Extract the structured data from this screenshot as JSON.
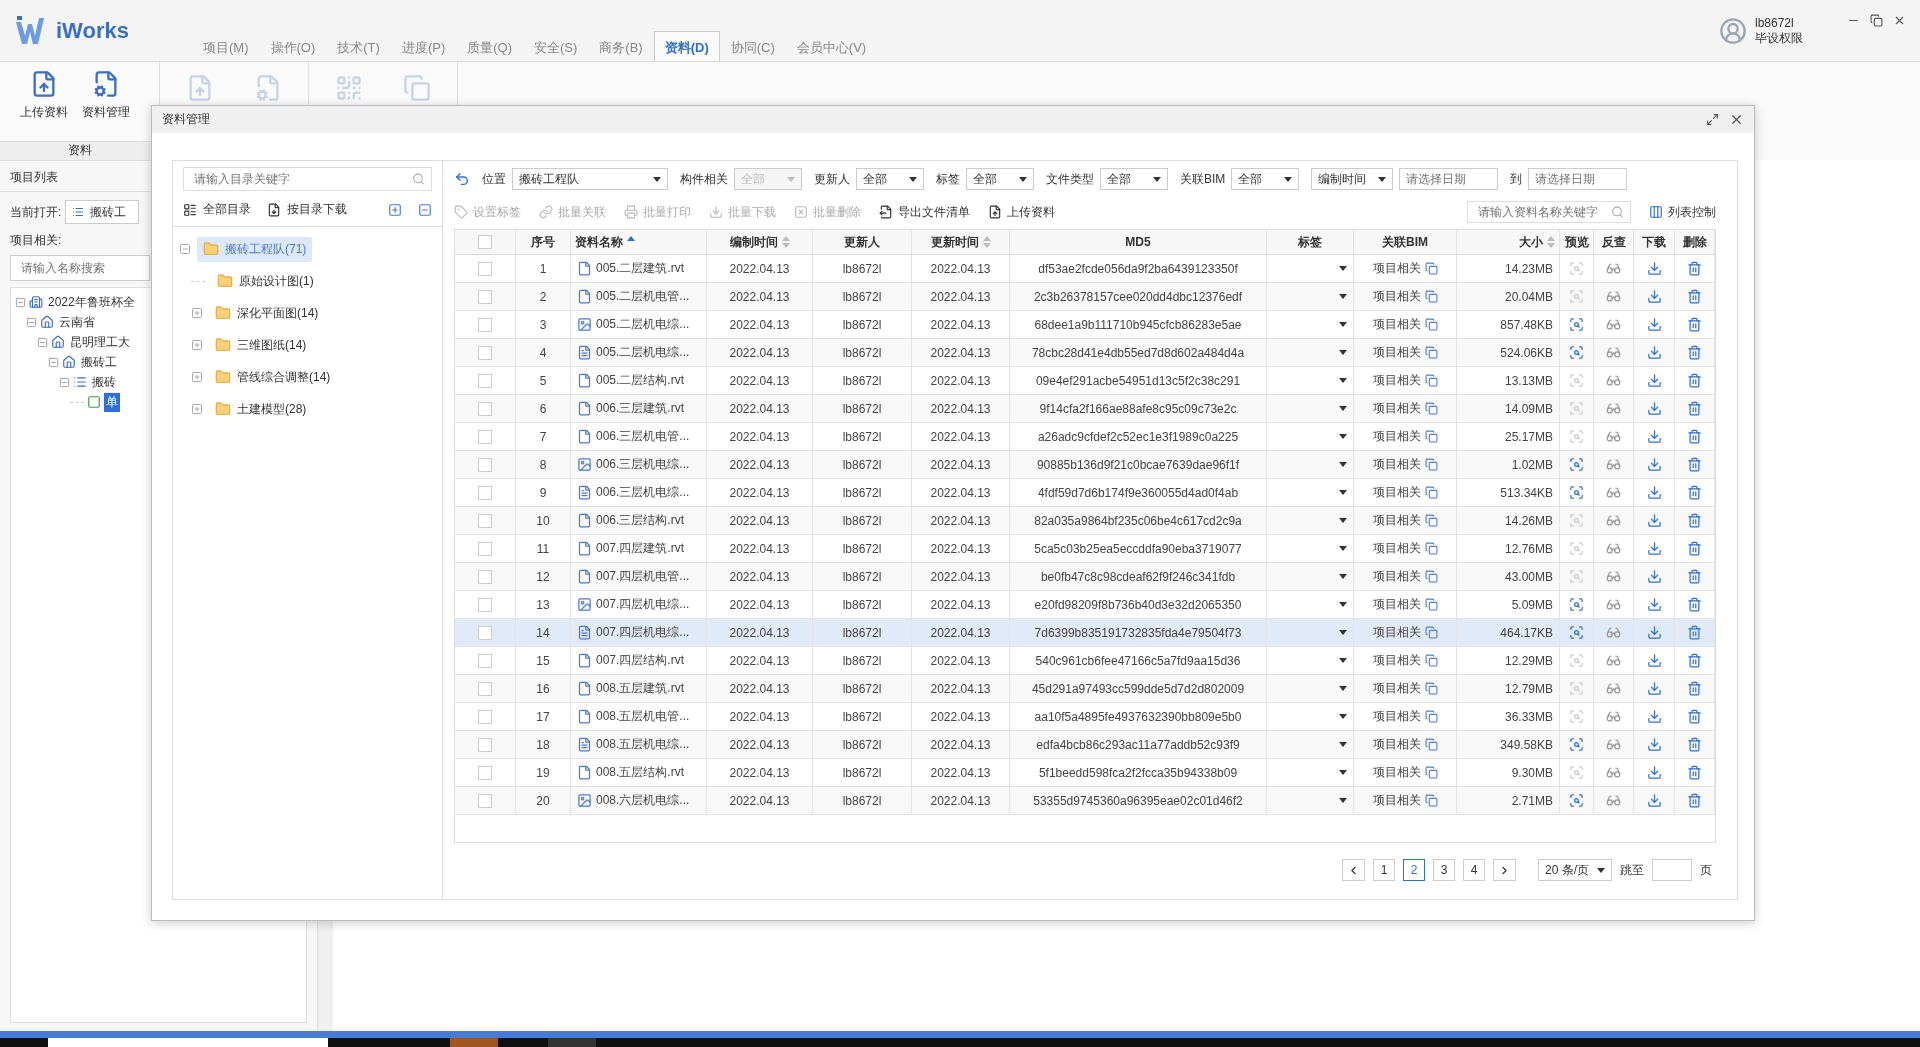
{
  "app": {
    "logo": "iWorks",
    "menu": [
      {
        "label": "项目(M)",
        "selected": false
      },
      {
        "label": "操作(O)",
        "selected": false
      },
      {
        "label": "技术(T)",
        "selected": false
      },
      {
        "label": "进度(P)",
        "selected": false
      },
      {
        "label": "质量(Q)",
        "selected": false
      },
      {
        "label": "安全(S)",
        "selected": false
      },
      {
        "label": "商务(B)",
        "selected": false
      },
      {
        "label": "资料(D)",
        "selected": true
      },
      {
        "label": "协同(C)",
        "selected": false
      },
      {
        "label": "会员中心(V)",
        "selected": false
      }
    ],
    "user": {
      "name": "lb8672l",
      "role": "毕设权限"
    }
  },
  "ribbon": {
    "buttons": [
      {
        "label": "上传资料",
        "kind": "upload"
      },
      {
        "label": "资料管理",
        "kind": "manage"
      }
    ],
    "group": "资料"
  },
  "project_panel": {
    "title": "项目列表",
    "current_label": "当前打开:",
    "current_value": "搬砖工",
    "related_label": "项目相关:",
    "search_placeholder": "请输入名称搜索",
    "tree": [
      {
        "label": "2022年鲁班杯全",
        "kind": "project",
        "expanded": true,
        "selected": false,
        "children": [
          {
            "label": "云南省",
            "kind": "org",
            "expanded": true,
            "selected": false,
            "children": [
              {
                "label": "昆明理工大",
                "kind": "org",
                "expanded": true,
                "selected": false,
                "children": [
                  {
                    "label": "搬砖工",
                    "kind": "org",
                    "expanded": true,
                    "selected": false,
                    "children": [
                      {
                        "label": "搬砖",
                        "kind": "team",
                        "expanded": true,
                        "selected": false,
                        "children": [
                          {
                            "label": "单",
                            "kind": "unit",
                            "selected": true
                          }
                        ]
                      }
                    ]
                  }
                ]
              }
            ]
          }
        ]
      }
    ]
  },
  "dialog": {
    "title": "资料管理",
    "tree_search_placeholder": "请输入目录关键字",
    "all_dirs": "全部目录",
    "download_by_dir": "按目录下载",
    "folders": [
      {
        "label": "搬砖工程队(71)",
        "selected": true,
        "expanded": true,
        "children": [
          {
            "label": "原始设计图(1)",
            "selected": false
          },
          {
            "label": "深化平面图(14)",
            "selected": false,
            "expanded": false
          },
          {
            "label": "三维图纸(14)",
            "selected": false,
            "expanded": false
          },
          {
            "label": "管线综合调整(14)",
            "selected": false,
            "expanded": false
          },
          {
            "label": "土建模型(28)",
            "selected": false,
            "expanded": false
          }
        ]
      }
    ],
    "filters": [
      {
        "label": "位置",
        "value": "搬砖工程队",
        "disabled": false
      },
      {
        "label": "构件相关",
        "value": "全部",
        "disabled": true
      },
      {
        "label": "更新人",
        "value": "全部",
        "disabled": false
      },
      {
        "label": "标签",
        "value": "全部",
        "disabled": false
      },
      {
        "label": "文件类型",
        "value": "全部",
        "disabled": false
      },
      {
        "label": "关联BIM",
        "value": "全部",
        "disabled": false
      }
    ],
    "date_filter": {
      "field": "编制时间",
      "from_placeholder": "请选择日期",
      "to_label": "到",
      "to_placeholder": "请选择日期"
    },
    "actions": [
      {
        "label": "设置标签",
        "kind": "tag",
        "disabled": true
      },
      {
        "label": "批量关联",
        "kind": "link",
        "disabled": true
      },
      {
        "label": "批量打印",
        "kind": "print",
        "disabled": true
      },
      {
        "label": "批量下载",
        "kind": "download",
        "disabled": true
      },
      {
        "label": "批量删除",
        "kind": "delete",
        "disabled": true
      },
      {
        "label": "导出文件清单",
        "kind": "export",
        "disabled": false
      },
      {
        "label": "上传资料",
        "kind": "upload",
        "disabled": false
      }
    ],
    "file_search_placeholder": "请输入资料名称关键字",
    "list_control": "列表控制",
    "table": {
      "all_checked": false,
      "columns": [
        {
          "label": "序号"
        },
        {
          "label": "资料名称",
          "sorted": true
        },
        {
          "label": "编制时间",
          "sorted": false
        },
        {
          "label": "更新人"
        },
        {
          "label": "更新时间",
          "sorted": false
        },
        {
          "label": "MD5"
        },
        {
          "label": "标签"
        },
        {
          "label": "关联BIM"
        },
        {
          "label": "大小",
          "sorted": false
        },
        {
          "label": "预览"
        },
        {
          "label": "反查"
        },
        {
          "label": "下载"
        },
        {
          "label": "删除"
        }
      ],
      "rows": [
        {
          "no": "1",
          "name": "005.二层建筑.rvt",
          "kind": "doc",
          "created": "2022.04.13",
          "updater": "lb8672l",
          "updated": "2022.04.13",
          "md5": "df53ae2fcde056da9f2ba6439123350f",
          "bim": "项目相关",
          "size": "14.23MB",
          "preview": false,
          "checked": false,
          "selected": false
        },
        {
          "no": "2",
          "name": "005.二层机电管...",
          "kind": "doc",
          "created": "2022.04.13",
          "updater": "lb8672l",
          "updated": "2022.04.13",
          "md5": "2c3b26378157cee020dd4dbc12376edf",
          "bim": "项目相关",
          "size": "20.04MB",
          "preview": false,
          "checked": false,
          "selected": false
        },
        {
          "no": "3",
          "name": "005.二层机电综...",
          "kind": "image",
          "created": "2022.04.13",
          "updater": "lb8672l",
          "updated": "2022.04.13",
          "md5": "68dee1a9b111710b945cfcb86283e5ae",
          "bim": "项目相关",
          "size": "857.48KB",
          "preview": true,
          "checked": false,
          "selected": false
        },
        {
          "no": "4",
          "name": "005.二层机电综...",
          "kind": "pdf",
          "created": "2022.04.13",
          "updater": "lb8672l",
          "updated": "2022.04.13",
          "md5": "78cbc28d41e4db55ed7d8d602a484d4a",
          "bim": "项目相关",
          "size": "524.06KB",
          "preview": true,
          "checked": false,
          "selected": false
        },
        {
          "no": "5",
          "name": "005.二层结构.rvt",
          "kind": "doc",
          "created": "2022.04.13",
          "updater": "lb8672l",
          "updated": "2022.04.13",
          "md5": "09e4ef291acbe54951d13c5f2c38c291",
          "bim": "项目相关",
          "size": "13.13MB",
          "preview": false,
          "checked": false,
          "selected": false
        },
        {
          "no": "6",
          "name": "006.三层建筑.rvt",
          "kind": "doc",
          "created": "2022.04.13",
          "updater": "lb8672l",
          "updated": "2022.04.13",
          "md5": "9f14cfa2f166ae88afe8c95c09c73e2c",
          "bim": "项目相关",
          "size": "14.09MB",
          "preview": false,
          "checked": false,
          "selected": false
        },
        {
          "no": "7",
          "name": "006.三层机电管...",
          "kind": "doc",
          "created": "2022.04.13",
          "updater": "lb8672l",
          "updated": "2022.04.13",
          "md5": "a26adc9cfdef2c52ec1e3f1989c0a225",
          "bim": "项目相关",
          "size": "25.17MB",
          "preview": false,
          "checked": false,
          "selected": false
        },
        {
          "no": "8",
          "name": "006.三层机电综...",
          "kind": "image",
          "created": "2022.04.13",
          "updater": "lb8672l",
          "updated": "2022.04.13",
          "md5": "90885b136d9f21c0bcae7639dae96f1f",
          "bim": "项目相关",
          "size": "1.02MB",
          "preview": true,
          "checked": false,
          "selected": false
        },
        {
          "no": "9",
          "name": "006.三层机电综...",
          "kind": "pdf",
          "created": "2022.04.13",
          "updater": "lb8672l",
          "updated": "2022.04.13",
          "md5": "4fdf59d7d6b174f9e360055d4ad0f4ab",
          "bim": "项目相关",
          "size": "513.34KB",
          "preview": true,
          "checked": false,
          "selected": false
        },
        {
          "no": "10",
          "name": "006.三层结构.rvt",
          "kind": "doc",
          "created": "2022.04.13",
          "updater": "lb8672l",
          "updated": "2022.04.13",
          "md5": "82a035a9864bf235c06be4c617cd2c9a",
          "bim": "项目相关",
          "size": "14.26MB",
          "preview": false,
          "checked": false,
          "selected": false
        },
        {
          "no": "11",
          "name": "007.四层建筑.rvt",
          "kind": "doc",
          "created": "2022.04.13",
          "updater": "lb8672l",
          "updated": "2022.04.13",
          "md5": "5ca5c03b25ea5eccddfa90eba3719077",
          "bim": "项目相关",
          "size": "12.76MB",
          "preview": false,
          "checked": false,
          "selected": false
        },
        {
          "no": "12",
          "name": "007.四层机电管...",
          "kind": "doc",
          "created": "2022.04.13",
          "updater": "lb8672l",
          "updated": "2022.04.13",
          "md5": "be0fb47c8c98cdeaf62f9f246c341fdb",
          "bim": "项目相关",
          "size": "43.00MB",
          "preview": false,
          "checked": false,
          "selected": false
        },
        {
          "no": "13",
          "name": "007.四层机电综...",
          "kind": "image",
          "created": "2022.04.13",
          "updater": "lb8672l",
          "updated": "2022.04.13",
          "md5": "e20fd98209f8b736b40d3e32d2065350",
          "bim": "项目相关",
          "size": "5.09MB",
          "preview": true,
          "checked": false,
          "selected": false
        },
        {
          "no": "14",
          "name": "007.四层机电综...",
          "kind": "pdf",
          "created": "2022.04.13",
          "updater": "lb8672l",
          "updated": "2022.04.13",
          "md5": "7d6399b835191732835fda4e79504f73",
          "bim": "项目相关",
          "size": "464.17KB",
          "preview": true,
          "checked": false,
          "selected": true
        },
        {
          "no": "15",
          "name": "007.四层结构.rvt",
          "kind": "doc",
          "created": "2022.04.13",
          "updater": "lb8672l",
          "updated": "2022.04.13",
          "md5": "540c961cb6fee47166c5a7fd9aa15d36",
          "bim": "项目相关",
          "size": "12.29MB",
          "preview": false,
          "checked": false,
          "selected": false
        },
        {
          "no": "16",
          "name": "008.五层建筑.rvt",
          "kind": "doc",
          "created": "2022.04.13",
          "updater": "lb8672l",
          "updated": "2022.04.13",
          "md5": "45d291a97493cc599dde5d7d2d802009",
          "bim": "项目相关",
          "size": "12.79MB",
          "preview": false,
          "checked": false,
          "selected": false
        },
        {
          "no": "17",
          "name": "008.五层机电管...",
          "kind": "doc",
          "created": "2022.04.13",
          "updater": "lb8672l",
          "updated": "2022.04.13",
          "md5": "aa10f5a4895fe4937632390bb809e5b0",
          "bim": "项目相关",
          "size": "36.33MB",
          "preview": false,
          "checked": false,
          "selected": false
        },
        {
          "no": "18",
          "name": "008.五层机电综...",
          "kind": "pdf",
          "created": "2022.04.13",
          "updater": "lb8672l",
          "updated": "2022.04.13",
          "md5": "edfa4bcb86c293ac11a77addb52c93f9",
          "bim": "项目相关",
          "size": "349.58KB",
          "preview": true,
          "checked": false,
          "selected": false
        },
        {
          "no": "19",
          "name": "008.五层结构.rvt",
          "kind": "doc",
          "created": "2022.04.13",
          "updater": "lb8672l",
          "updated": "2022.04.13",
          "md5": "5f1beedd598fca2f2fcca35b94338b09",
          "bim": "项目相关",
          "size": "9.30MB",
          "preview": false,
          "checked": false,
          "selected": false
        },
        {
          "no": "20",
          "name": "008.六层机电综...",
          "kind": "image",
          "created": "2022.04.13",
          "updater": "lb8672l",
          "updated": "2022.04.13",
          "md5": "53355d9745360a96395eae02c01d46f2",
          "bim": "项目相关",
          "size": "2.71MB",
          "preview": true,
          "checked": false,
          "selected": false
        }
      ]
    },
    "pagination": {
      "pages": [
        {
          "label": "1",
          "selected": false
        },
        {
          "label": "2",
          "selected": true
        },
        {
          "label": "3",
          "selected": false
        },
        {
          "label": "4",
          "selected": false
        }
      ],
      "page_size": "20 条/页",
      "jump_label": "跳至",
      "page_unit": "页"
    }
  }
}
